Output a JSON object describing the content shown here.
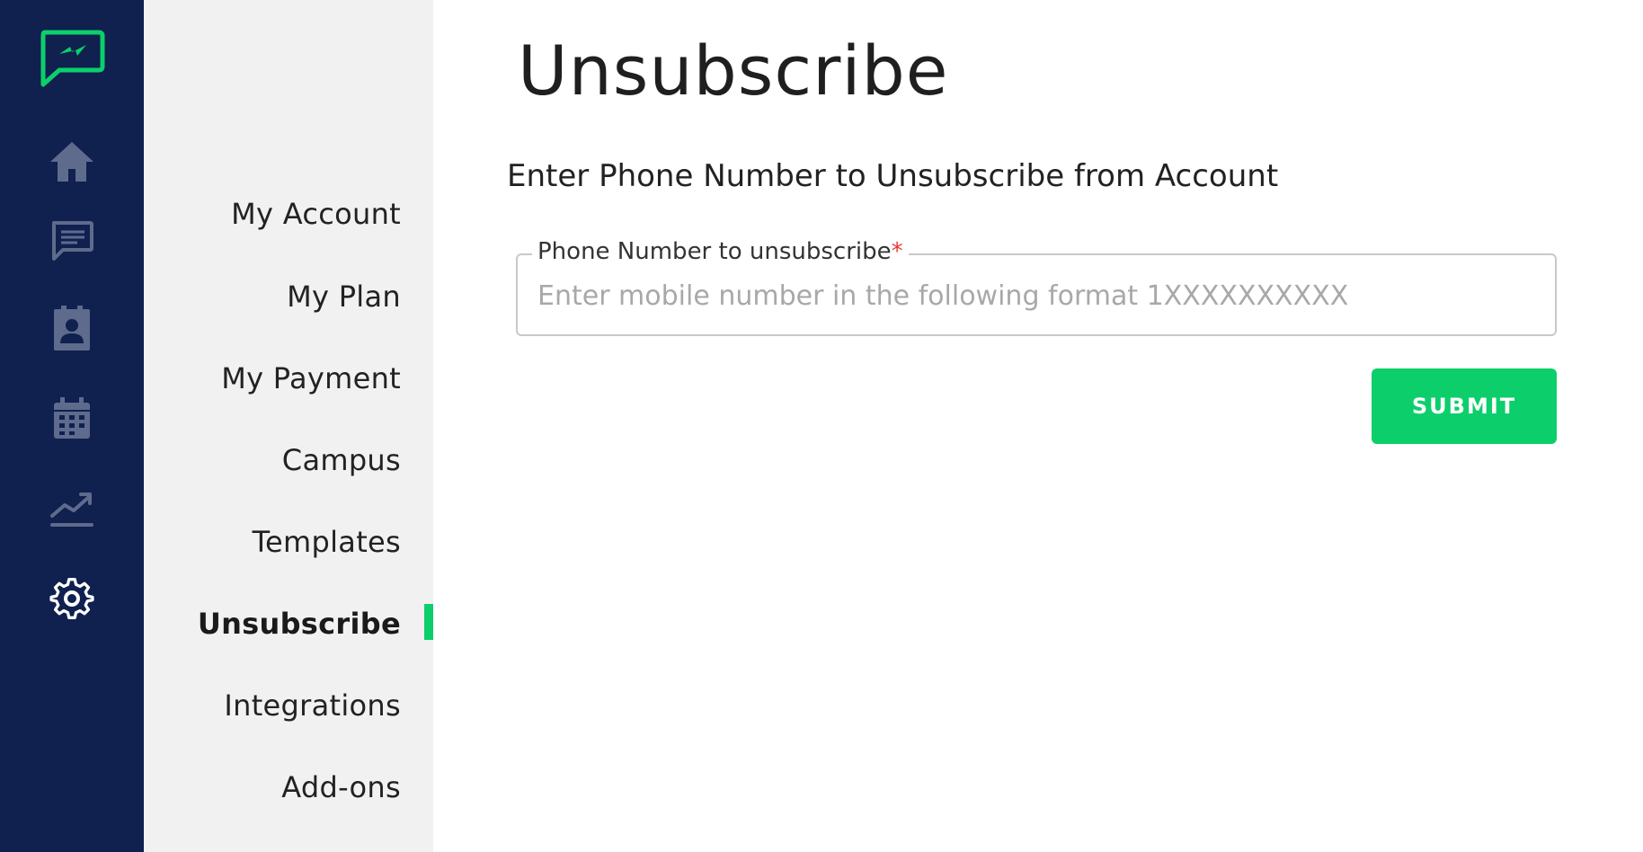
{
  "colors": {
    "rail_background": "#10204f",
    "rail_icon": "#5f6b8c",
    "rail_icon_active": "#ffffff",
    "brand_accent": "#0ccf6b",
    "subnav_background": "#f1f1f1",
    "required_marker": "#e53935"
  },
  "rail": {
    "logo_icon": "lightning-chat-icon",
    "items": [
      {
        "icon": "home-icon"
      },
      {
        "icon": "messages-icon"
      },
      {
        "icon": "contacts-icon"
      },
      {
        "icon": "calendar-icon"
      },
      {
        "icon": "analytics-icon"
      },
      {
        "icon": "gear-icon",
        "active": true
      }
    ]
  },
  "subnav": {
    "items": [
      {
        "label": "My Account"
      },
      {
        "label": "My Plan"
      },
      {
        "label": "My Payment"
      },
      {
        "label": "Campus"
      },
      {
        "label": "Templates"
      },
      {
        "label": "Unsubscribe",
        "active": true
      },
      {
        "label": "Integrations"
      },
      {
        "label": "Add-ons"
      }
    ]
  },
  "main": {
    "title": "Unsubscribe",
    "subtitle": "Enter Phone Number to Unsubscribe from Account",
    "phone_field": {
      "label": "Phone Number to unsubscribe",
      "required_marker": "*",
      "placeholder": "Enter mobile number in the following format 1XXXXXXXXXX",
      "value": ""
    },
    "submit_label": "SUBMIT"
  }
}
